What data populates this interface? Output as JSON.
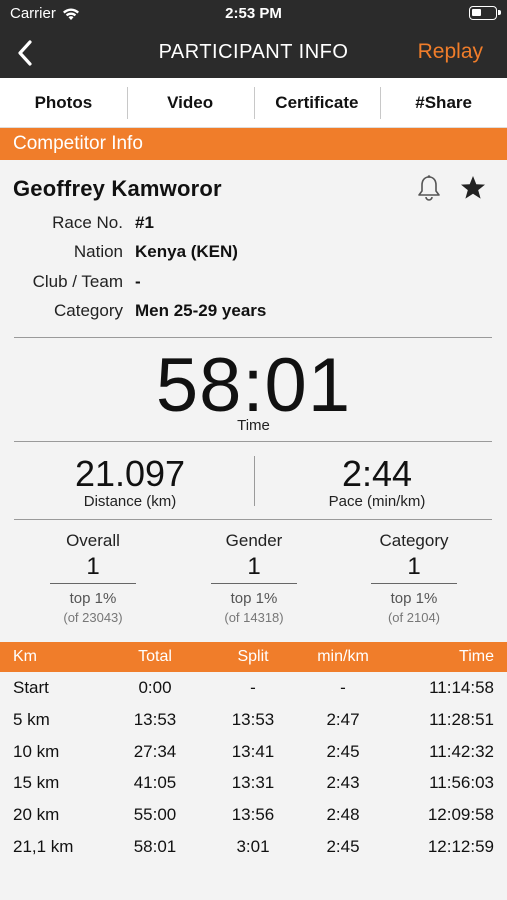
{
  "status_bar": {
    "carrier": "Carrier",
    "time": "2:53 PM"
  },
  "nav": {
    "title": "PARTICIPANT INFO",
    "replay": "Replay"
  },
  "tabs": [
    {
      "label": "Photos"
    },
    {
      "label": "Video"
    },
    {
      "label": "Certificate"
    },
    {
      "label": "#Share"
    }
  ],
  "section_title": "Competitor Info",
  "athlete": {
    "name": "Geoffrey Kamworor",
    "fields": [
      {
        "label": "Race No.",
        "value": "#1"
      },
      {
        "label": "Nation",
        "value": "Kenya (KEN)"
      },
      {
        "label": "Club / Team",
        "value": "-"
      },
      {
        "label": "Category",
        "value": "Men 25-29 years"
      }
    ]
  },
  "result": {
    "time": "58:01",
    "time_label": "Time",
    "distance": "21.097",
    "distance_label": "Distance (km)",
    "pace": "2:44",
    "pace_label": "Pace (min/km)"
  },
  "rankings": [
    {
      "title": "Overall",
      "value": "1",
      "pct": "top 1%",
      "of": "(of 23043)"
    },
    {
      "title": "Gender",
      "value": "1",
      "pct": "top 1%",
      "of": "(of 14318)"
    },
    {
      "title": "Category",
      "value": "1",
      "pct": "top 1%",
      "of": "(of 2104)"
    }
  ],
  "splits": {
    "headers": {
      "km": "Km",
      "total": "Total",
      "split": "Split",
      "pace": "min/km",
      "time": "Time"
    },
    "rows": [
      {
        "km": "Start",
        "total": "0:00",
        "split": "-",
        "pace": "-",
        "time": "11:14:58"
      },
      {
        "km": "5 km",
        "total": "13:53",
        "split": "13:53",
        "pace": "2:47",
        "time": "11:28:51"
      },
      {
        "km": "10 km",
        "total": "27:34",
        "split": "13:41",
        "pace": "2:45",
        "time": "11:42:32"
      },
      {
        "km": "15 km",
        "total": "41:05",
        "split": "13:31",
        "pace": "2:43",
        "time": "11:56:03"
      },
      {
        "km": "20 km",
        "total": "55:00",
        "split": "13:56",
        "pace": "2:48",
        "time": "12:09:58"
      },
      {
        "km": "21,1 km",
        "total": "58:01",
        "split": "3:01",
        "pace": "2:45",
        "time": "12:12:59"
      }
    ]
  },
  "colors": {
    "accent": "#f07d2a",
    "nav_bg": "#2b2b2b"
  }
}
